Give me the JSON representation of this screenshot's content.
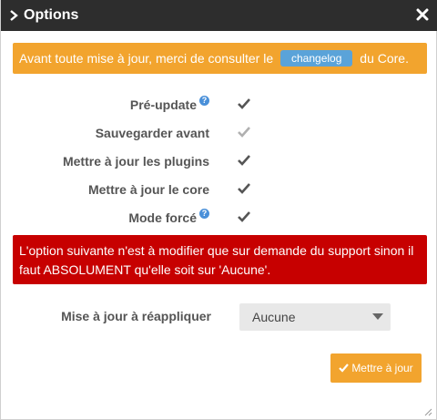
{
  "window": {
    "title": "Options",
    "close_icon": "close-icon",
    "chevron_icon": "chevron-right-icon"
  },
  "warning": {
    "text_before": "Avant toute mise à jour, merci de consulter le",
    "link_label": "changelog",
    "text_after": "du Core.",
    "color": "#f2a42e"
  },
  "options": [
    {
      "label": "Pré-update",
      "help": true,
      "checked": true,
      "disabled": false
    },
    {
      "label": "Sauvegarder avant",
      "help": false,
      "checked": true,
      "disabled": true
    },
    {
      "label": "Mettre à jour les plugins",
      "help": false,
      "checked": true,
      "disabled": false
    },
    {
      "label": "Mettre à jour le core",
      "help": false,
      "checked": true,
      "disabled": false
    },
    {
      "label": "Mode forcé",
      "help": true,
      "checked": true,
      "disabled": false
    }
  ],
  "help_glyph": "?",
  "danger": {
    "text": "L'option suivante n'est à modifier que sur demande du support sinon il faut ABSOLUMENT qu'elle soit sur 'Aucune'.",
    "color": "#c70000"
  },
  "reapply": {
    "label": "Mise à jour à réappliquer",
    "selected": "Aucune"
  },
  "submit": {
    "label": "Mettre à jour",
    "icon": "check-icon"
  }
}
